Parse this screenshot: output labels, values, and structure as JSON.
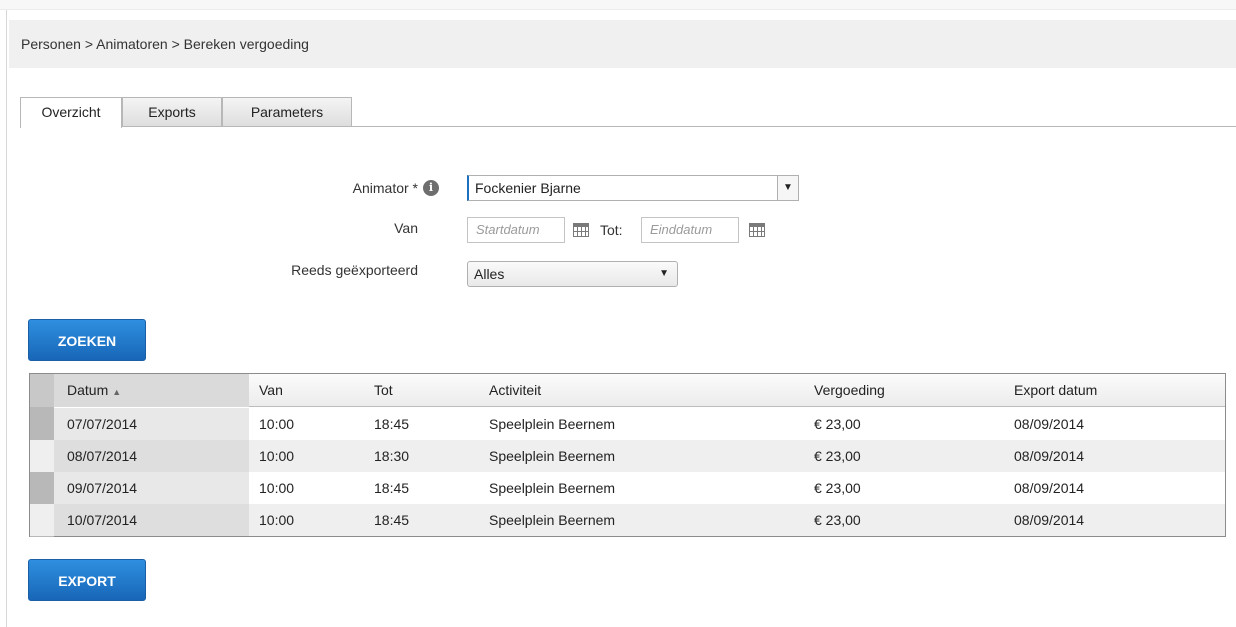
{
  "breadcrumb": "Personen > Animatoren > Bereken vergoeding",
  "tabs": [
    {
      "label": "Overzicht",
      "active": true
    },
    {
      "label": "Exports",
      "active": false
    },
    {
      "label": "Parameters",
      "active": false
    }
  ],
  "form": {
    "animator_label": "Animator *",
    "animator_value": "Fockenier Bjarne",
    "van_label": "Van",
    "start_placeholder": "Startdatum",
    "tot_label": "Tot:",
    "end_placeholder": "Einddatum",
    "exported_label": "Reeds geëxporteerd",
    "exported_value": "Alles"
  },
  "buttons": {
    "search": "ZOEKEN",
    "export": "EXPORT"
  },
  "table": {
    "columns": [
      "Datum",
      "Van",
      "Tot",
      "Activiteit",
      "Vergoeding",
      "Export datum"
    ],
    "sorted_column": "Datum",
    "sort_direction": "ascending",
    "rows": [
      [
        "07/07/2014",
        "10:00",
        "18:45",
        "Speelplein Beernem",
        "€ 23,00",
        "08/09/2014"
      ],
      [
        "08/07/2014",
        "10:00",
        "18:30",
        "Speelplein Beernem",
        "€ 23,00",
        "08/09/2014"
      ],
      [
        "09/07/2014",
        "10:00",
        "18:45",
        "Speelplein Beernem",
        "€ 23,00",
        "08/09/2014"
      ],
      [
        "10/07/2014",
        "10:00",
        "18:45",
        "Speelplein Beernem",
        "€ 23,00",
        "08/09/2014"
      ]
    ]
  },
  "icons": {
    "info": "info-icon",
    "calendar": "calendar-icon",
    "dropdown": "chevron-down-icon",
    "sort": "sort-ascending-icon"
  },
  "colors": {
    "button_blue": "#1f78cf",
    "input_focus": "#1f6fc0"
  }
}
